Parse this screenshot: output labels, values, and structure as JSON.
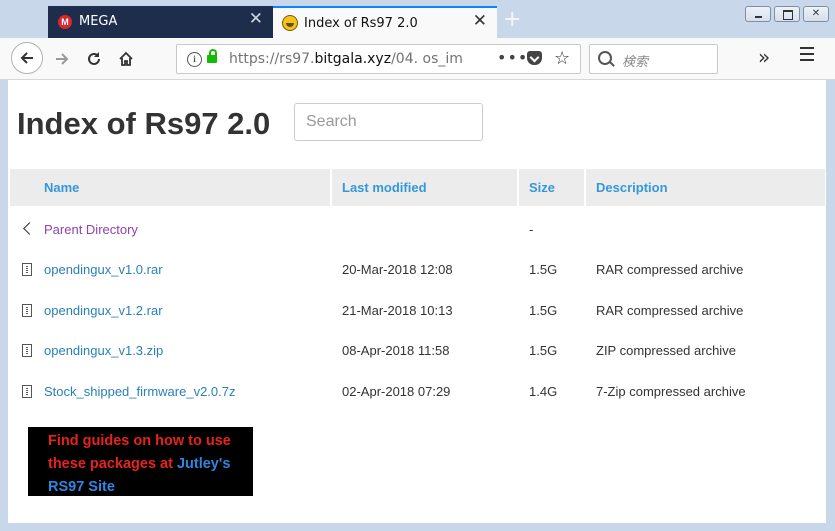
{
  "browser": {
    "tabs": [
      {
        "title": "MEGA",
        "close": "✕",
        "icon": "mega-logo",
        "icon_letter": "M"
      },
      {
        "title": "Index of Rs97 2.0",
        "close": "✕",
        "icon": "rs97-favicon"
      }
    ],
    "new_tab": "+",
    "url_gray_prefix": "https://rs97.",
    "url_host": "bitgala.xyz",
    "url_gray_suffix": "/04. os_im",
    "page_actions": "•••",
    "search_placeholder": "検索",
    "overflow": "»",
    "accent_color": "#0a84ff"
  },
  "page": {
    "title": "Index of Rs97 2.0",
    "search_placeholder": "Search",
    "columns": {
      "name": "Name",
      "modified": "Last modified",
      "size": "Size",
      "description": "Description"
    },
    "parent": {
      "name": "Parent Directory",
      "size": "-"
    },
    "rows": [
      {
        "name": "opendingux_v1.0.rar",
        "modified": "20-Mar-2018 12:08",
        "size": "1.5G",
        "description": "RAR compressed archive"
      },
      {
        "name": "opendingux_v1.2.rar",
        "modified": "21-Mar-2018 10:13",
        "size": "1.5G",
        "description": "RAR compressed archive"
      },
      {
        "name": "opendingux_v1.3.zip",
        "modified": "08-Apr-2018 11:58",
        "size": "1.5G",
        "description": "ZIP compressed archive"
      },
      {
        "name": "Stock_shipped_firmware_v2.0.7z",
        "modified": "02-Apr-2018 07:29",
        "size": "1.4G",
        "description": "7-Zip compressed archive"
      }
    ],
    "banner": {
      "text_1": "Find guides on how to use these packages at ",
      "link_1": "Jutley's RS97 Site"
    },
    "colors": {
      "header_link": "#3498db",
      "file_link": "#2980b9",
      "parent_link": "#8e44ad",
      "banner_red": "#e8221d",
      "banner_blue": "#2e86de"
    }
  }
}
